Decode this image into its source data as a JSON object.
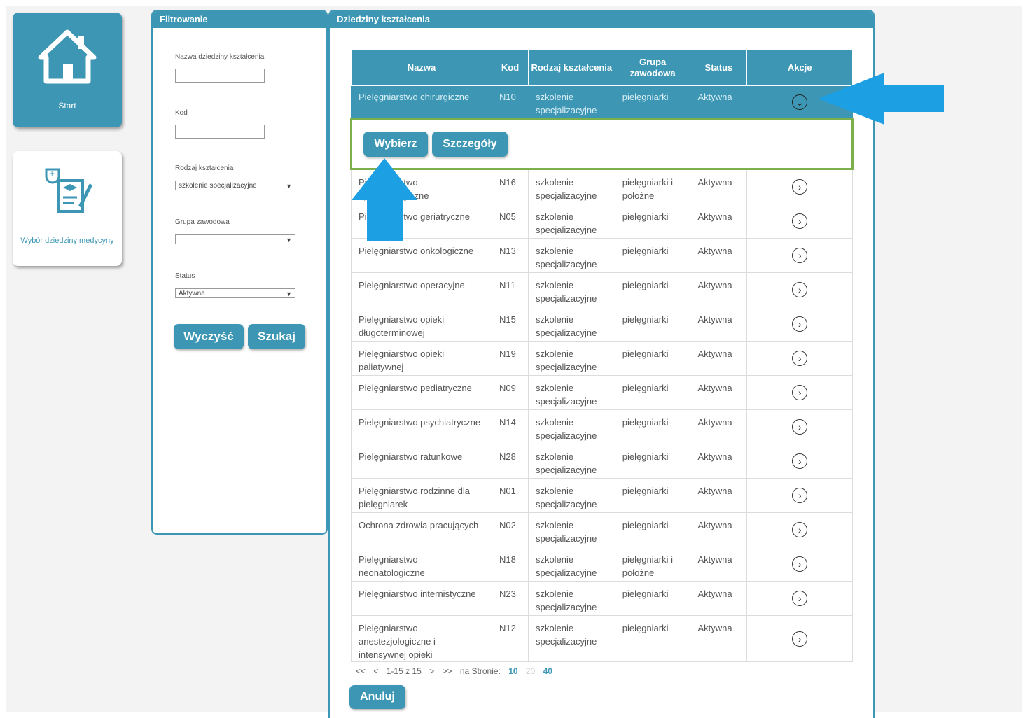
{
  "nav": {
    "start_label": "Start",
    "wybor_label": "Wybór dziedziny medycyny"
  },
  "filter": {
    "title": "Filtrowanie",
    "nazwa_label": "Nazwa dziedziny kształcenia",
    "nazwa_value": "",
    "kod_label": "Kod",
    "kod_value": "",
    "rodzaj_label": "Rodzaj kształcenia",
    "rodzaj_value": "szkolenie specjalizacyjne",
    "grupa_label": "Grupa zawodowa",
    "grupa_value": "",
    "status_label": "Status",
    "status_value": "Aktywna",
    "clear_label": "Wyczyść",
    "search_label": "Szukaj"
  },
  "main": {
    "title": "Dziedziny kształcenia",
    "columns": [
      "Nazwa",
      "Kod",
      "Rodzaj kształcenia",
      "Grupa zawodowa",
      "Status",
      "Akcje"
    ],
    "selected_row": {
      "nazwa": "Pielęgniarstwo chirurgiczne",
      "kod": "N10",
      "rodzaj": "szkolenie specjalizacyjne",
      "grupa": "pielęgniarki",
      "status": "Aktywna"
    },
    "row_actions": {
      "choose": "Wybierz",
      "details": "Szczegóły"
    },
    "rows": [
      {
        "nazwa": "Pielęgniarstwo epidemiologiczne",
        "kod": "N16",
        "rodzaj": "szkolenie specjalizacyjne",
        "grupa": "pielęgniarki i położne",
        "status": "Aktywna"
      },
      {
        "nazwa": "Pielęgniarstwo geriatryczne",
        "kod": "N05",
        "rodzaj": "szkolenie specjalizacyjne",
        "grupa": "pielęgniarki",
        "status": "Aktywna"
      },
      {
        "nazwa": "Pielęgniarstwo onkologiczne",
        "kod": "N13",
        "rodzaj": "szkolenie specjalizacyjne",
        "grupa": "pielęgniarki",
        "status": "Aktywna"
      },
      {
        "nazwa": "Pielęgniarstwo operacyjne",
        "kod": "N11",
        "rodzaj": "szkolenie specjalizacyjne",
        "grupa": "pielęgniarki",
        "status": "Aktywna"
      },
      {
        "nazwa": "Pielęgniarstwo opieki długoterminowej",
        "kod": "N15",
        "rodzaj": "szkolenie specjalizacyjne",
        "grupa": "pielęgniarki",
        "status": "Aktywna"
      },
      {
        "nazwa": "Pielęgniarstwo opieki paliatywnej",
        "kod": "N19",
        "rodzaj": "szkolenie specjalizacyjne",
        "grupa": "pielęgniarki",
        "status": "Aktywna"
      },
      {
        "nazwa": "Pielęgniarstwo pediatryczne",
        "kod": "N09",
        "rodzaj": "szkolenie specjalizacyjne",
        "grupa": "pielęgniarki",
        "status": "Aktywna"
      },
      {
        "nazwa": "Pielęgniarstwo psychiatryczne",
        "kod": "N14",
        "rodzaj": "szkolenie specjalizacyjne",
        "grupa": "pielęgniarki",
        "status": "Aktywna"
      },
      {
        "nazwa": "Pielęgniarstwo ratunkowe",
        "kod": "N28",
        "rodzaj": "szkolenie specjalizacyjne",
        "grupa": "pielęgniarki",
        "status": "Aktywna"
      },
      {
        "nazwa": "Pielęgniarstwo rodzinne dla pielęgniarek",
        "kod": "N01",
        "rodzaj": "szkolenie specjalizacyjne",
        "grupa": "pielęgniarki",
        "status": "Aktywna"
      },
      {
        "nazwa": "Ochrona zdrowia pracujących",
        "kod": "N02",
        "rodzaj": "szkolenie specjalizacyjne",
        "grupa": "pielęgniarki",
        "status": "Aktywna"
      },
      {
        "nazwa": "Pielęgniarstwo neonatologiczne",
        "kod": "N18",
        "rodzaj": "szkolenie specjalizacyjne",
        "grupa": "pielęgniarki i położne",
        "status": "Aktywna"
      },
      {
        "nazwa": "Pielęgniarstwo internistyczne",
        "kod": "N23",
        "rodzaj": "szkolenie specjalizacyjne",
        "grupa": "pielęgniarki",
        "status": "Aktywna"
      },
      {
        "nazwa": "Pielęgniarstwo anestezjologiczne i intensywnej opieki",
        "kod": "N12",
        "rodzaj": "szkolenie specjalizacyjne",
        "grupa": "pielęgniarki",
        "status": "Aktywna"
      }
    ],
    "pager": {
      "first": "<<",
      "prev": "<",
      "range": "1-15 z 15",
      "next": ">",
      "last": ">>",
      "per_page_label": "na Stronie:",
      "sizes": [
        "10",
        "20",
        "40"
      ]
    },
    "cancel_label": "Anuluj"
  },
  "colors": {
    "accent": "#3d97b4",
    "highlight_border": "#7bb04a",
    "annotation_arrow": "#1d9fe3"
  }
}
